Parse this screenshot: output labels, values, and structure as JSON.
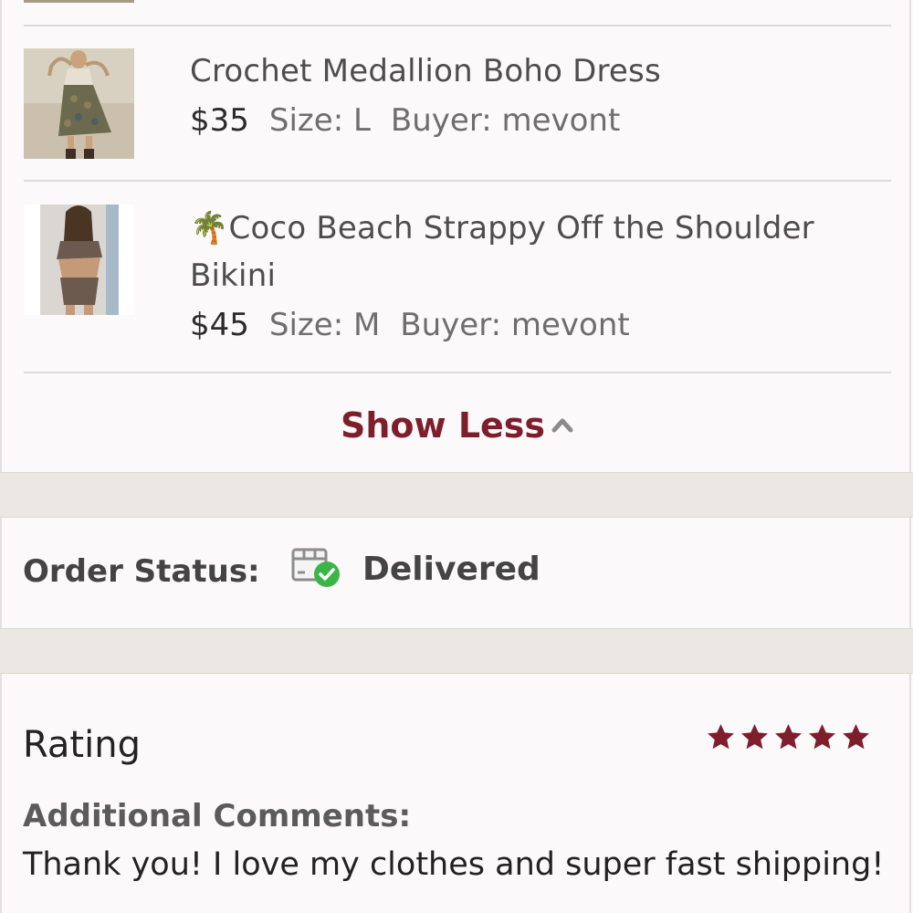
{
  "items": [
    {
      "title": "Crochet Medallion Boho Dress",
      "price": "$35",
      "size": "Size: L",
      "buyer": "Buyer: mevont",
      "image_icon": "dress-photo-thumbnail"
    },
    {
      "emoji": "🌴",
      "title_line1": "Coco Beach Strappy Off the Shoulder",
      "title_line2": "Bikini",
      "price": "$45",
      "size": "Size: M",
      "buyer": "Buyer: mevont",
      "image_icon": "bikini-photo-thumbnail"
    }
  ],
  "show_less_label": "Show Less",
  "order_status": {
    "label": "Order Status:",
    "value": "Delivered",
    "icon": "delivered-package-icon"
  },
  "rating": {
    "label": "Rating",
    "stars": 5,
    "max_stars": 5
  },
  "comments": {
    "label": "Additional Comments:",
    "text": "Thank you! I love my clothes and super fast shipping!"
  },
  "colors": {
    "accent": "#7e1e2d",
    "success": "#3cb548",
    "background": "#fbf9fa",
    "gap": "#ebe8e3"
  }
}
